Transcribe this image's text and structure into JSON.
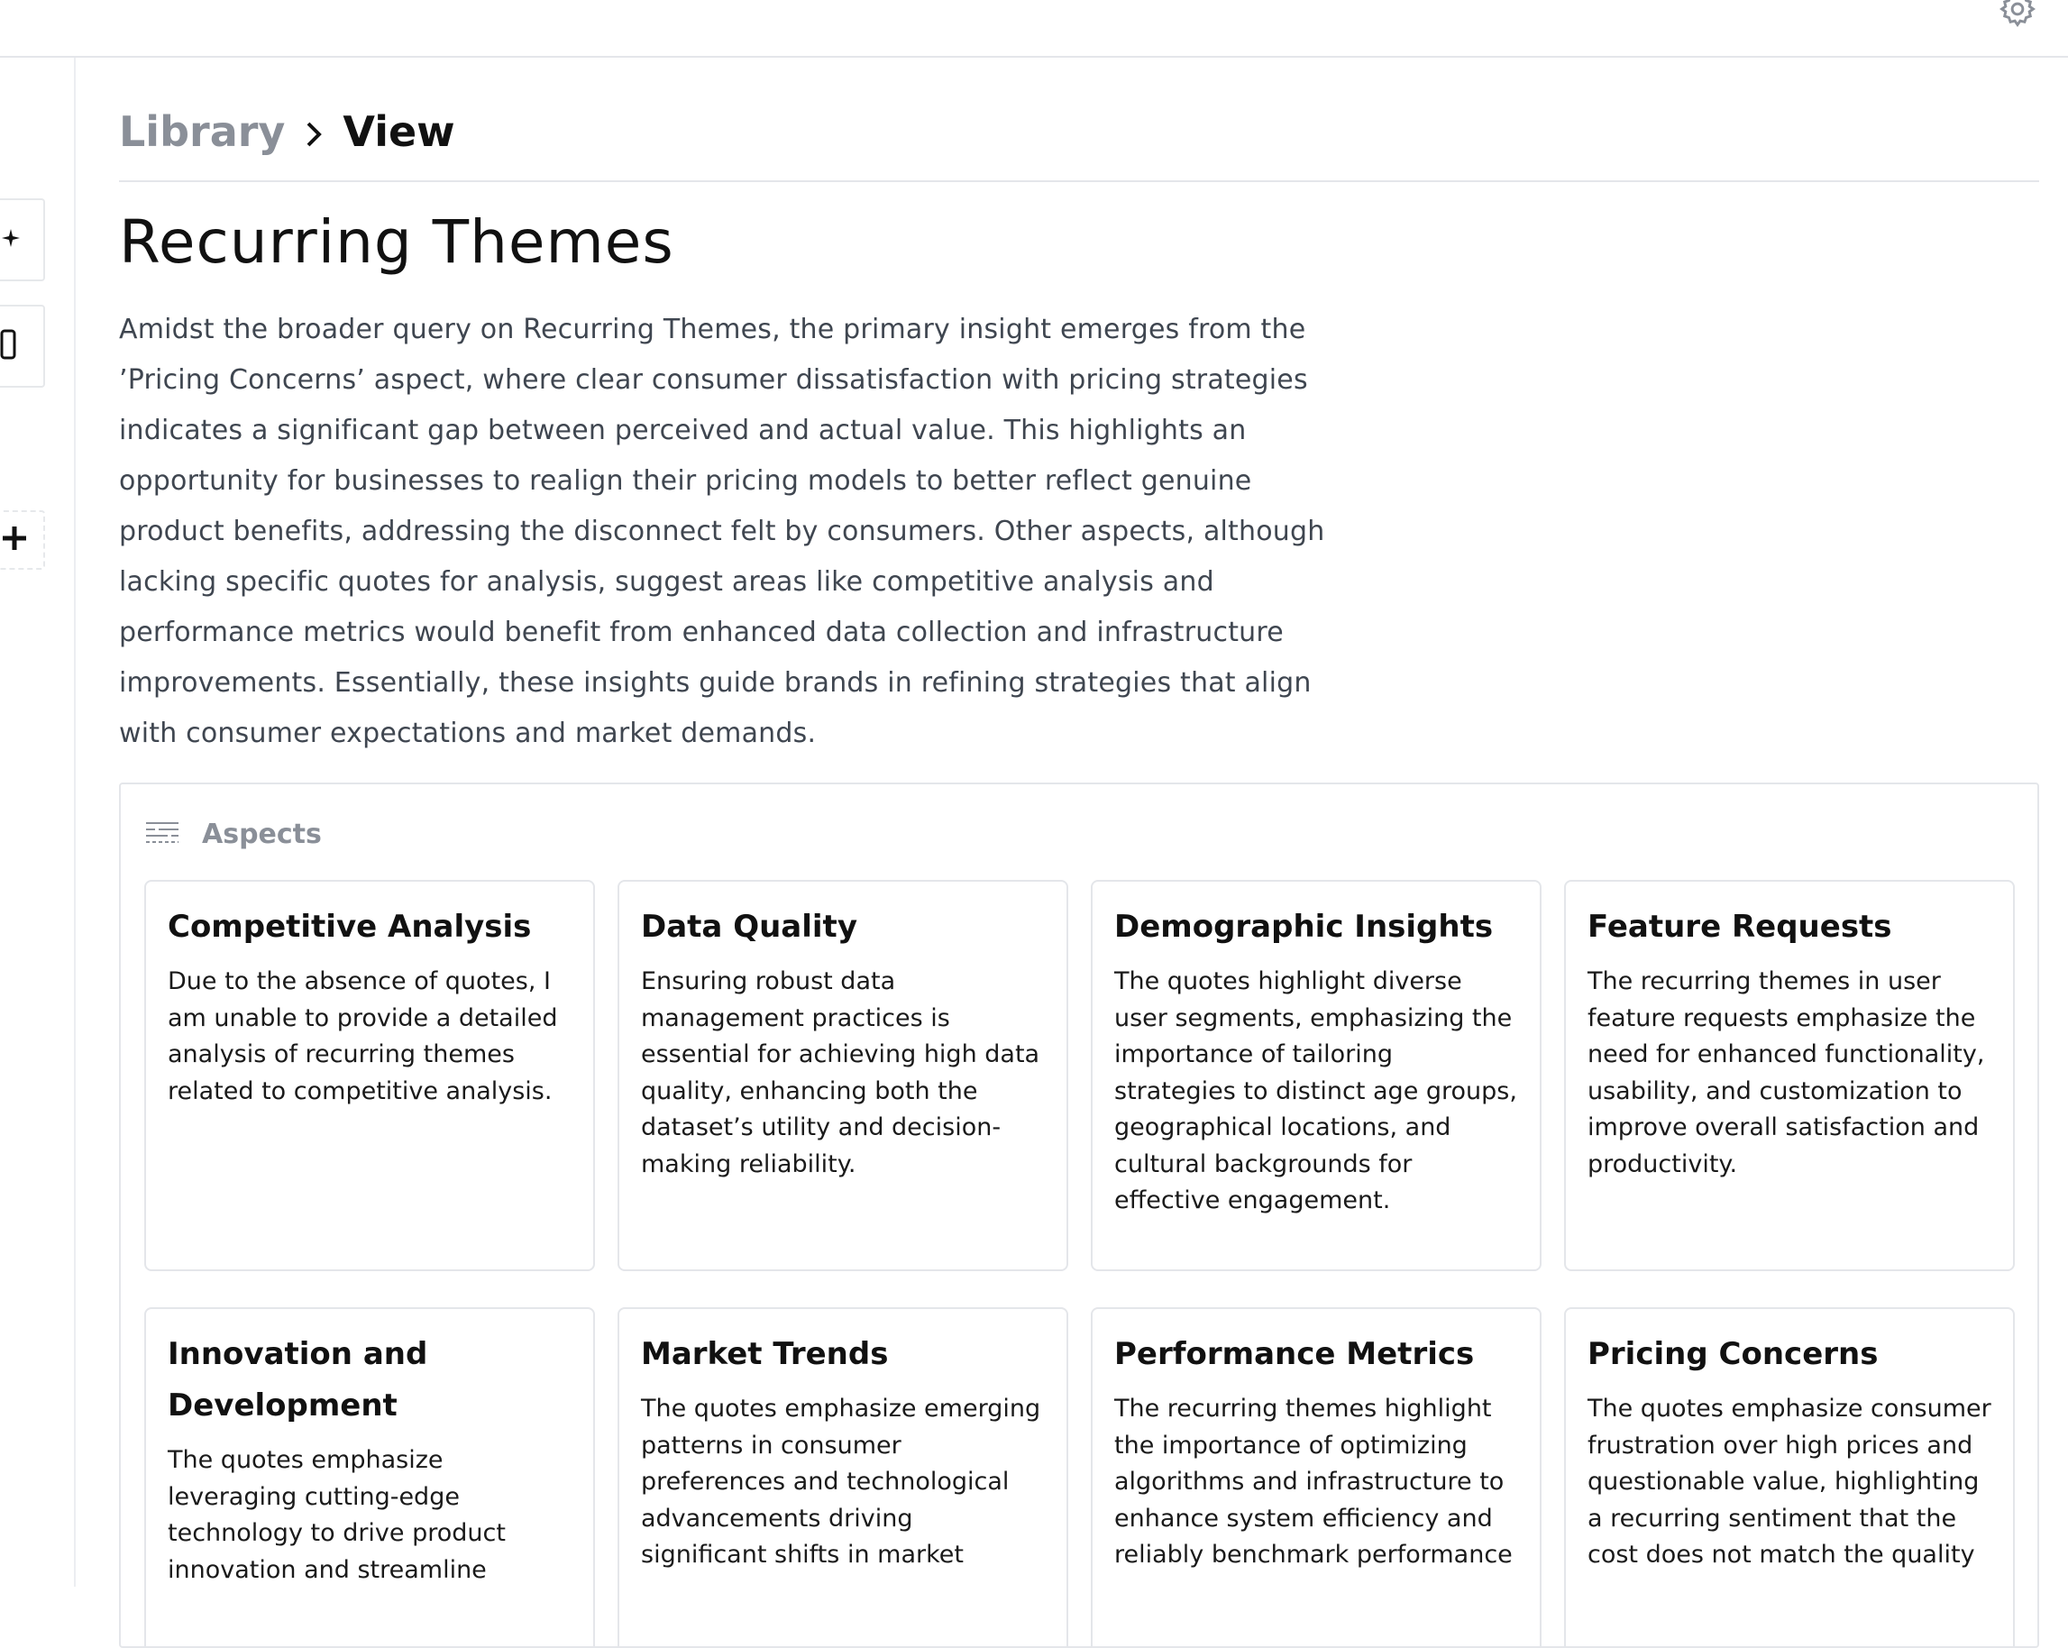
{
  "header": {
    "settings_icon": "gear-icon"
  },
  "left_rail": {
    "items": [
      {
        "icon": "sparkle-icon"
      },
      {
        "icon": "document-icon"
      },
      {
        "icon": "plus-icon"
      }
    ]
  },
  "breadcrumb": {
    "parent": "Library",
    "current": "View"
  },
  "page": {
    "title": "Recurring Themes",
    "summary": "Amidst the broader query on Recurring Themes, the primary insight emerges from the ’Pricing Concerns’ aspect, where clear consumer dissatisfaction with pricing strategies indicates a significant gap between perceived and actual value. This highlights an opportunity for businesses to realign their pricing models to better reflect genuine product benefits, addressing the disconnect felt by consumers. Other aspects, although lacking specific quotes for analysis, suggest areas like competitive analysis and performance metrics would benefit from enhanced data collection and infrastructure improvements. Essentially, these insights guide brands in refining strategies that align with consumer expectations and market demands."
  },
  "aspects": {
    "label": "Aspects",
    "icon": "filter-lines-icon",
    "cards": [
      {
        "title": "Competitive Analysis",
        "text": "Due to the absence of quotes, I am unable to provide a detailed analysis of recurring themes related to competitive analysis."
      },
      {
        "title": "Data Quality",
        "text": "Ensuring robust data management practices is essential for achieving high data quality, enhancing both the dataset’s utility and decision-making reliability."
      },
      {
        "title": "Demographic Insights",
        "text": "The quotes highlight diverse user segments, emphasizing the importance of tailoring strategies to distinct age groups, geographical locations, and cultural backgrounds for effective engagement."
      },
      {
        "title": "Feature Requests",
        "text": "The recurring themes in user feature requests emphasize the need for enhanced functionality, usability, and customization to improve overall satisfaction and productivity."
      },
      {
        "title": "Innovation and Development",
        "text": "The quotes emphasize leveraging cutting-edge technology to drive product innovation and streamline"
      },
      {
        "title": "Market Trends",
        "text": "The quotes emphasize emerging patterns in consumer preferences and technological advancements driving significant shifts in market"
      },
      {
        "title": "Performance Metrics",
        "text": "The recurring themes highlight the importance of optimizing algorithms and infrastructure to enhance system efficiency and reliably benchmark performance"
      },
      {
        "title": "Pricing Concerns",
        "text": "The quotes emphasize consumer frustration over high prices and questionable value, highlighting a recurring sentiment that the cost does not match the quality"
      }
    ]
  }
}
